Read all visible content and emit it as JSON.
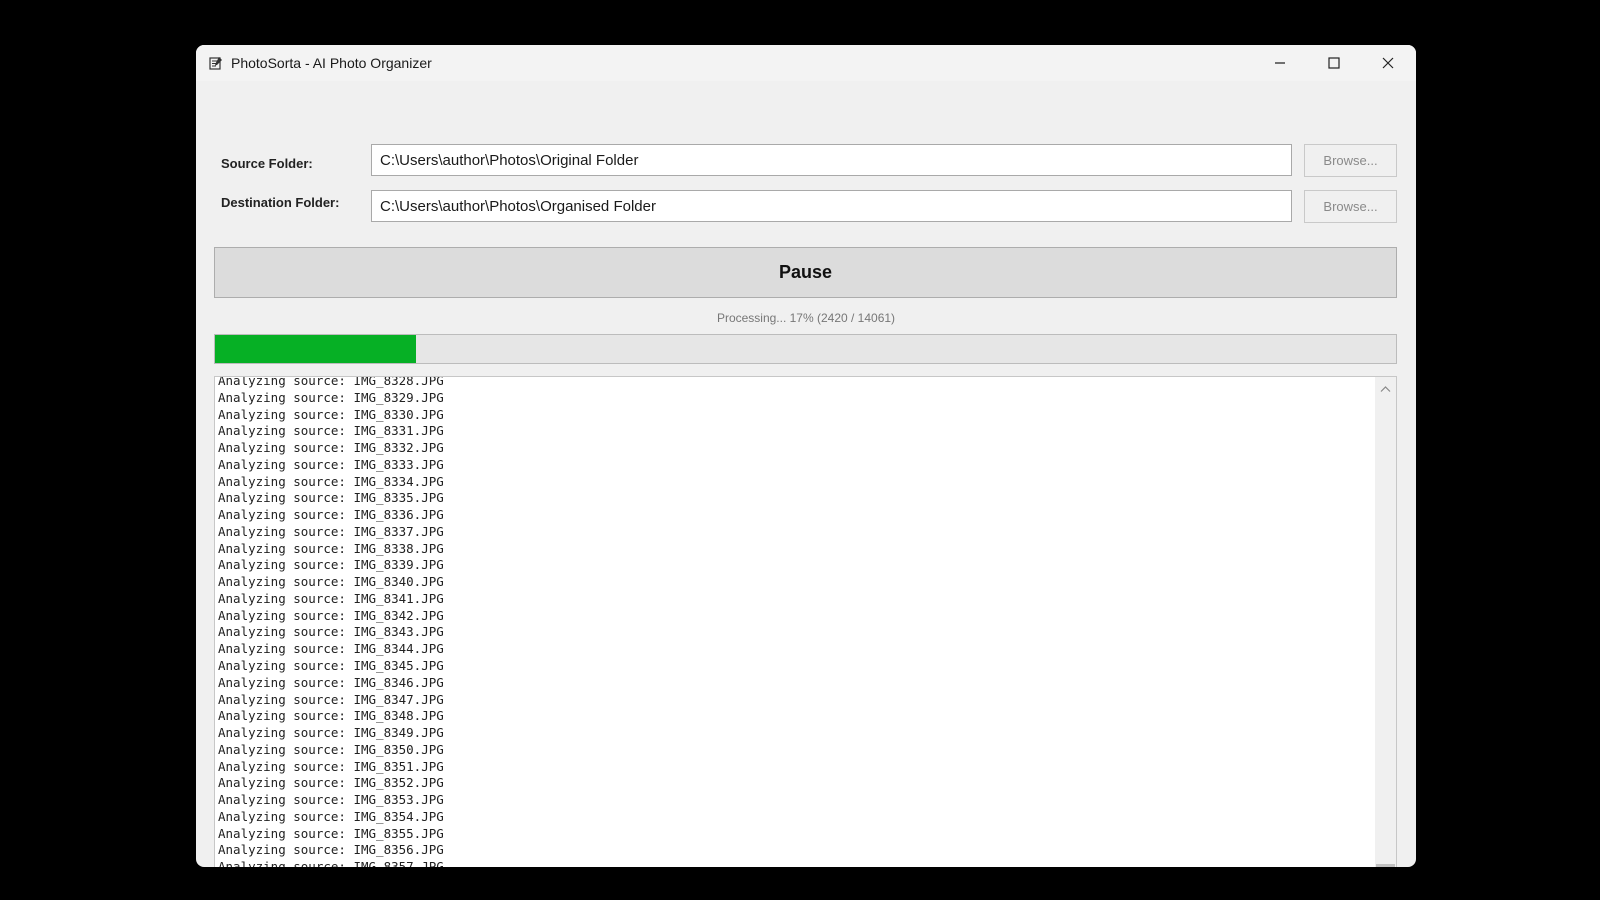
{
  "window": {
    "title": "PhotoSorta - AI Photo Organizer"
  },
  "source": {
    "label": "Source Folder:",
    "value": "C:\\Users\\author\\Photos\\Original Folder",
    "browse_label": "Browse..."
  },
  "destination": {
    "label": "Destination Folder:",
    "value": "C:\\Users\\author\\Photos\\Organised Folder",
    "browse_label": "Browse..."
  },
  "pause_label": "Pause",
  "status": {
    "text": "Processing... 17% (2420 / 14061)",
    "progress_fraction": 0.17
  },
  "colors": {
    "progress_fill": "#06b025"
  },
  "log": {
    "lines": [
      "Analyzing source: IMG_8328.JPG",
      "Analyzing source: IMG_8329.JPG",
      "Analyzing source: IMG_8330.JPG",
      "Analyzing source: IMG_8331.JPG",
      "Analyzing source: IMG_8332.JPG",
      "Analyzing source: IMG_8333.JPG",
      "Analyzing source: IMG_8334.JPG",
      "Analyzing source: IMG_8335.JPG",
      "Analyzing source: IMG_8336.JPG",
      "Analyzing source: IMG_8337.JPG",
      "Analyzing source: IMG_8338.JPG",
      "Analyzing source: IMG_8339.JPG",
      "Analyzing source: IMG_8340.JPG",
      "Analyzing source: IMG_8341.JPG",
      "Analyzing source: IMG_8342.JPG",
      "Analyzing source: IMG_8343.JPG",
      "Analyzing source: IMG_8344.JPG",
      "Analyzing source: IMG_8345.JPG",
      "Analyzing source: IMG_8346.JPG",
      "Analyzing source: IMG_8347.JPG",
      "Analyzing source: IMG_8348.JPG",
      "Analyzing source: IMG_8349.JPG",
      "Analyzing source: IMG_8350.JPG",
      "Analyzing source: IMG_8351.JPG",
      "Analyzing source: IMG_8352.JPG",
      "Analyzing source: IMG_8353.JPG",
      "Analyzing source: IMG_8354.JPG",
      "Analyzing source: IMG_8355.JPG",
      "Analyzing source: IMG_8356.JPG",
      "Analyzing source: IMG_8357.JPG"
    ]
  }
}
